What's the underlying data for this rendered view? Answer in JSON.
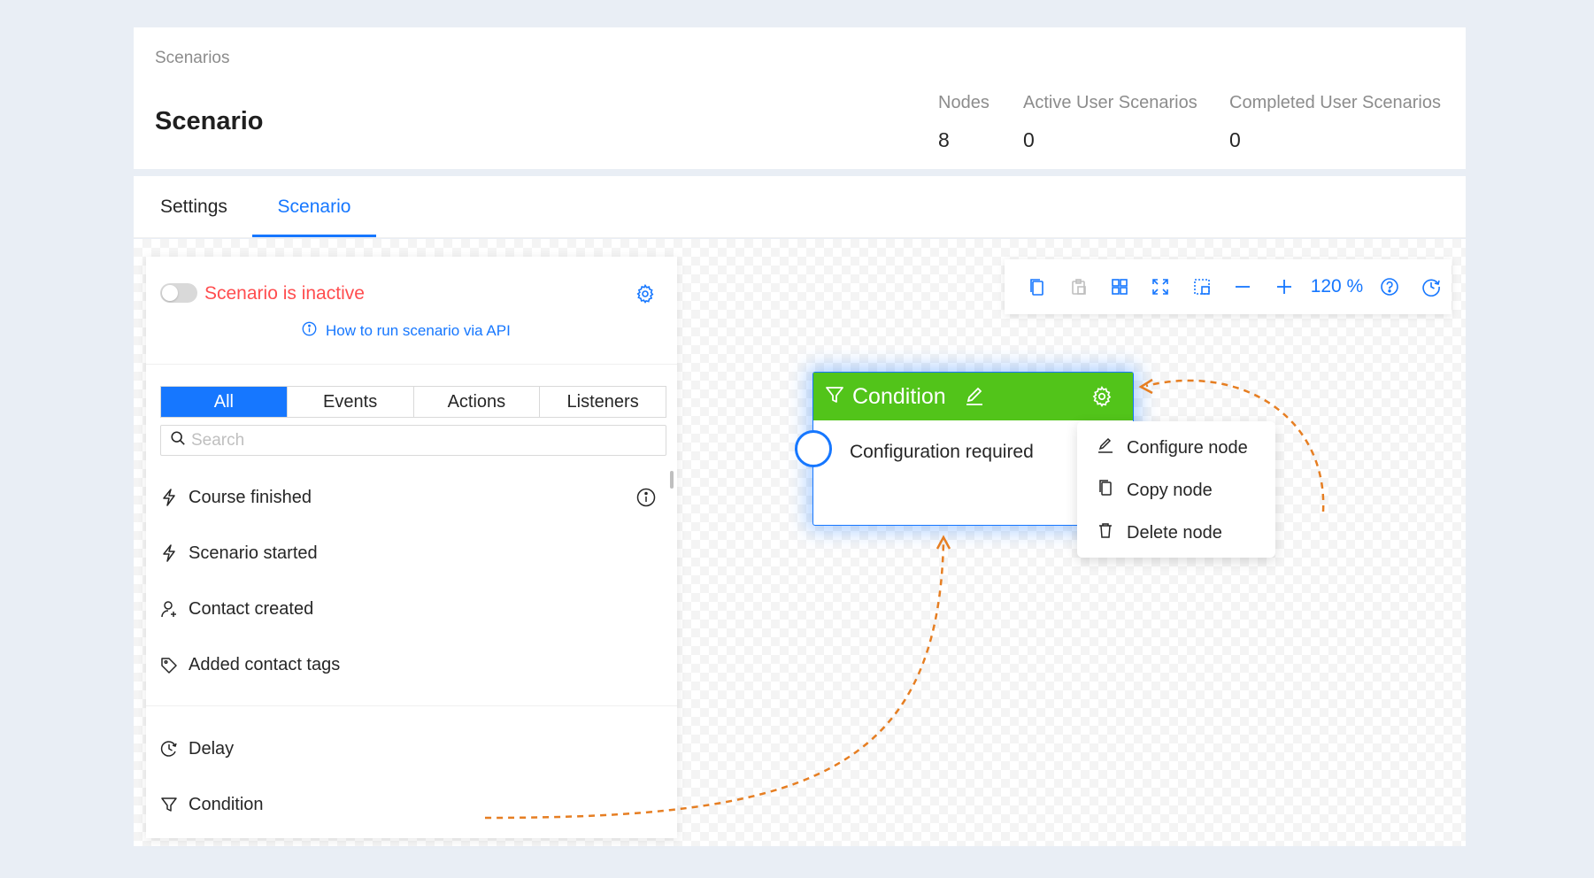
{
  "header": {
    "breadcrumb": "Scenarios",
    "title": "Scenario",
    "stats": [
      {
        "label": "Nodes",
        "value": "8"
      },
      {
        "label": "Active User Scenarios",
        "value": "0"
      },
      {
        "label": "Completed User Scenarios",
        "value": "0"
      }
    ]
  },
  "tabs": [
    {
      "label": "Settings",
      "active": false
    },
    {
      "label": "Scenario",
      "active": true
    }
  ],
  "panel": {
    "status_label": "Scenario is inactive",
    "active": false,
    "api_link": "How to run scenario via API",
    "filters": [
      "All",
      "Events",
      "Actions",
      "Listeners"
    ],
    "active_filter": "All",
    "search_placeholder": "Search",
    "events": [
      {
        "label": "Course finished",
        "icon": "lightning-icon"
      },
      {
        "label": "Scenario started",
        "icon": "lightning-icon"
      },
      {
        "label": "Contact created",
        "icon": "user-add-icon"
      },
      {
        "label": "Added contact tags",
        "icon": "tag-icon"
      }
    ],
    "actions": [
      {
        "label": "Delay",
        "icon": "clock-icon"
      },
      {
        "label": "Condition",
        "icon": "filter-icon"
      }
    ]
  },
  "toolbar": {
    "zoom": "120 %",
    "buttons": [
      "copy-icon",
      "paste-icon",
      "grid-icon",
      "fit-icon",
      "select-icon",
      "zoom-out-icon",
      "zoom-in-icon",
      "help-icon",
      "history-icon"
    ]
  },
  "node": {
    "title": "Condition",
    "body": "Configuration required",
    "header_color": "#52c41a"
  },
  "context_menu": [
    {
      "label": "Configure node",
      "icon": "edit-icon"
    },
    {
      "label": "Copy node",
      "icon": "copy-icon"
    },
    {
      "label": "Delete node",
      "icon": "trash-icon"
    }
  ],
  "colors": {
    "accent": "#1677ff",
    "danger": "#ff4d4f",
    "annotation": "#e67e22"
  }
}
